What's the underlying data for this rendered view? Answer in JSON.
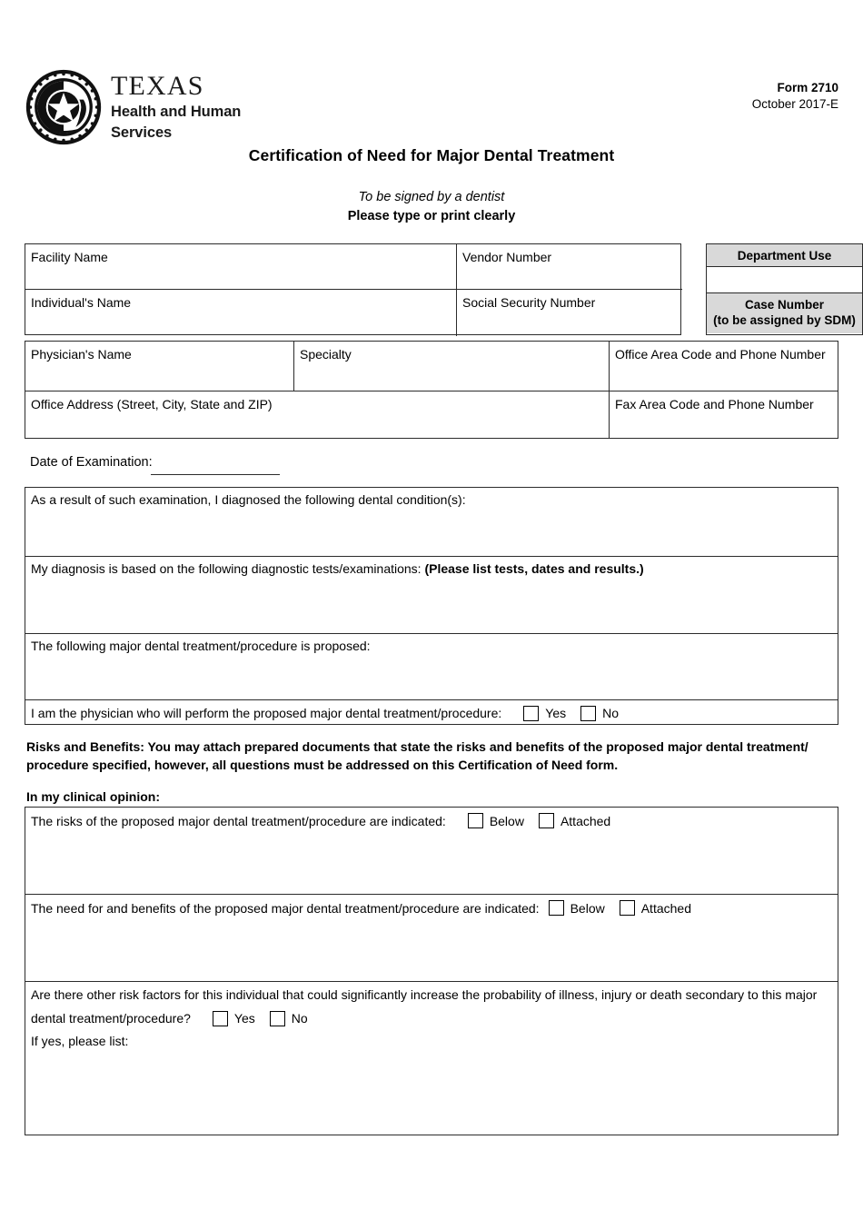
{
  "header": {
    "logo_texas": "TEXAS",
    "logo_sub_line1": "Health and Human",
    "logo_sub_line2": "Services",
    "form_number": "Form 2710",
    "form_date": "October 2017-E",
    "title": "Certification of Need for Major Dental Treatment",
    "subtitle_italic": "To be signed by a dentist",
    "subtitle_bold": "Please type or print clearly"
  },
  "facility_table": {
    "facility_name": "Facility Name",
    "vendor_number": "Vendor Number",
    "individuals_name": "Individual's Name",
    "social_security_number": "Social Security Number",
    "department_use": "Department Use",
    "case_number": "Case Number",
    "case_number_note": "(to be assigned by SDM)"
  },
  "physician_table": {
    "physicians_name": "Physician's Name",
    "specialty": "Specialty",
    "office_phone": "Office Area Code and Phone Number",
    "office_address": "Office Address (Street, City, State and ZIP)",
    "fax_phone": "Fax Area Code and Phone Number"
  },
  "exam": {
    "date_label": "Date of Examination:",
    "date_value": ""
  },
  "diagnosis": {
    "conditions": "As a result of such examination, I diagnosed the following dental condition(s):",
    "tests_prefix": "My diagnosis is based on the following diagnostic tests/examinations: ",
    "tests_bold": "(Please list tests, dates and results.)",
    "proposed": "The following major dental treatment/procedure is proposed:",
    "performer_question": "I am the physician who will perform the proposed major dental treatment/procedure:",
    "yes": "Yes",
    "no": "No"
  },
  "risks_benefits": {
    "paragraph": "Risks and Benefits: You may attach prepared documents that state the risks and benefits of the proposed major dental treatment/ procedure specified, however, all questions must be addressed on this Certification of Need form.",
    "clinical_opinion_heading": "In my clinical opinion:"
  },
  "opinion": {
    "risks_indicated": "The risks of the proposed major dental treatment/procedure are indicated:",
    "benefits_indicated": "The need for and benefits of the proposed major dental treatment/procedure are indicated:",
    "below": "Below",
    "attached": "Attached",
    "other_risk_line1": "Are there other risk factors for this individual that could significantly increase the probability of illness, injury or death secondary to this major",
    "other_risk_line2": "dental treatment/procedure?",
    "yes": "Yes",
    "no": "No",
    "if_yes": "If yes, please list:"
  },
  "colors": {
    "border": "#2b2b2b",
    "shaded_header": "#d9d9d9",
    "text": "#000000"
  }
}
